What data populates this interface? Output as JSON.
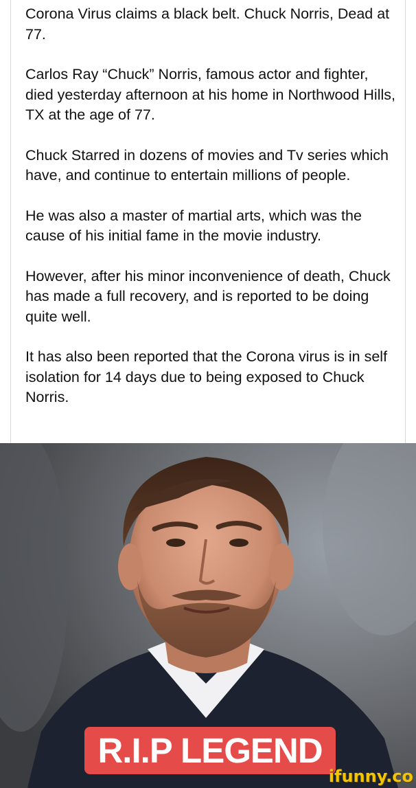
{
  "post": {
    "paragraphs": [
      "Corona Virus claims a black belt. Chuck Norris, Dead at 77.",
      "Carlos Ray “Chuck” Norris, famous actor and fighter, died yesterday afternoon at his home in Northwood Hills, TX at the age of 77.",
      "Chuck Starred in dozens of movies and Tv series which have, and continue to entertain millions of people.",
      "He was also a master of martial arts, which was the cause of his initial fame in the movie industry.",
      "However, after his minor inconvenience of death, Chuck has made a full recovery, and is reported to be doing quite well.",
      "It has also been reported that the Corona virus is in self isolation for 14 days due to being exposed to Chuck Norris."
    ]
  },
  "banner": {
    "text": "R.I.P LEGEND"
  },
  "watermark": {
    "text": "ifunny.co"
  },
  "colors": {
    "banner_bg": "#e44b49",
    "watermark": "#f5c400"
  }
}
